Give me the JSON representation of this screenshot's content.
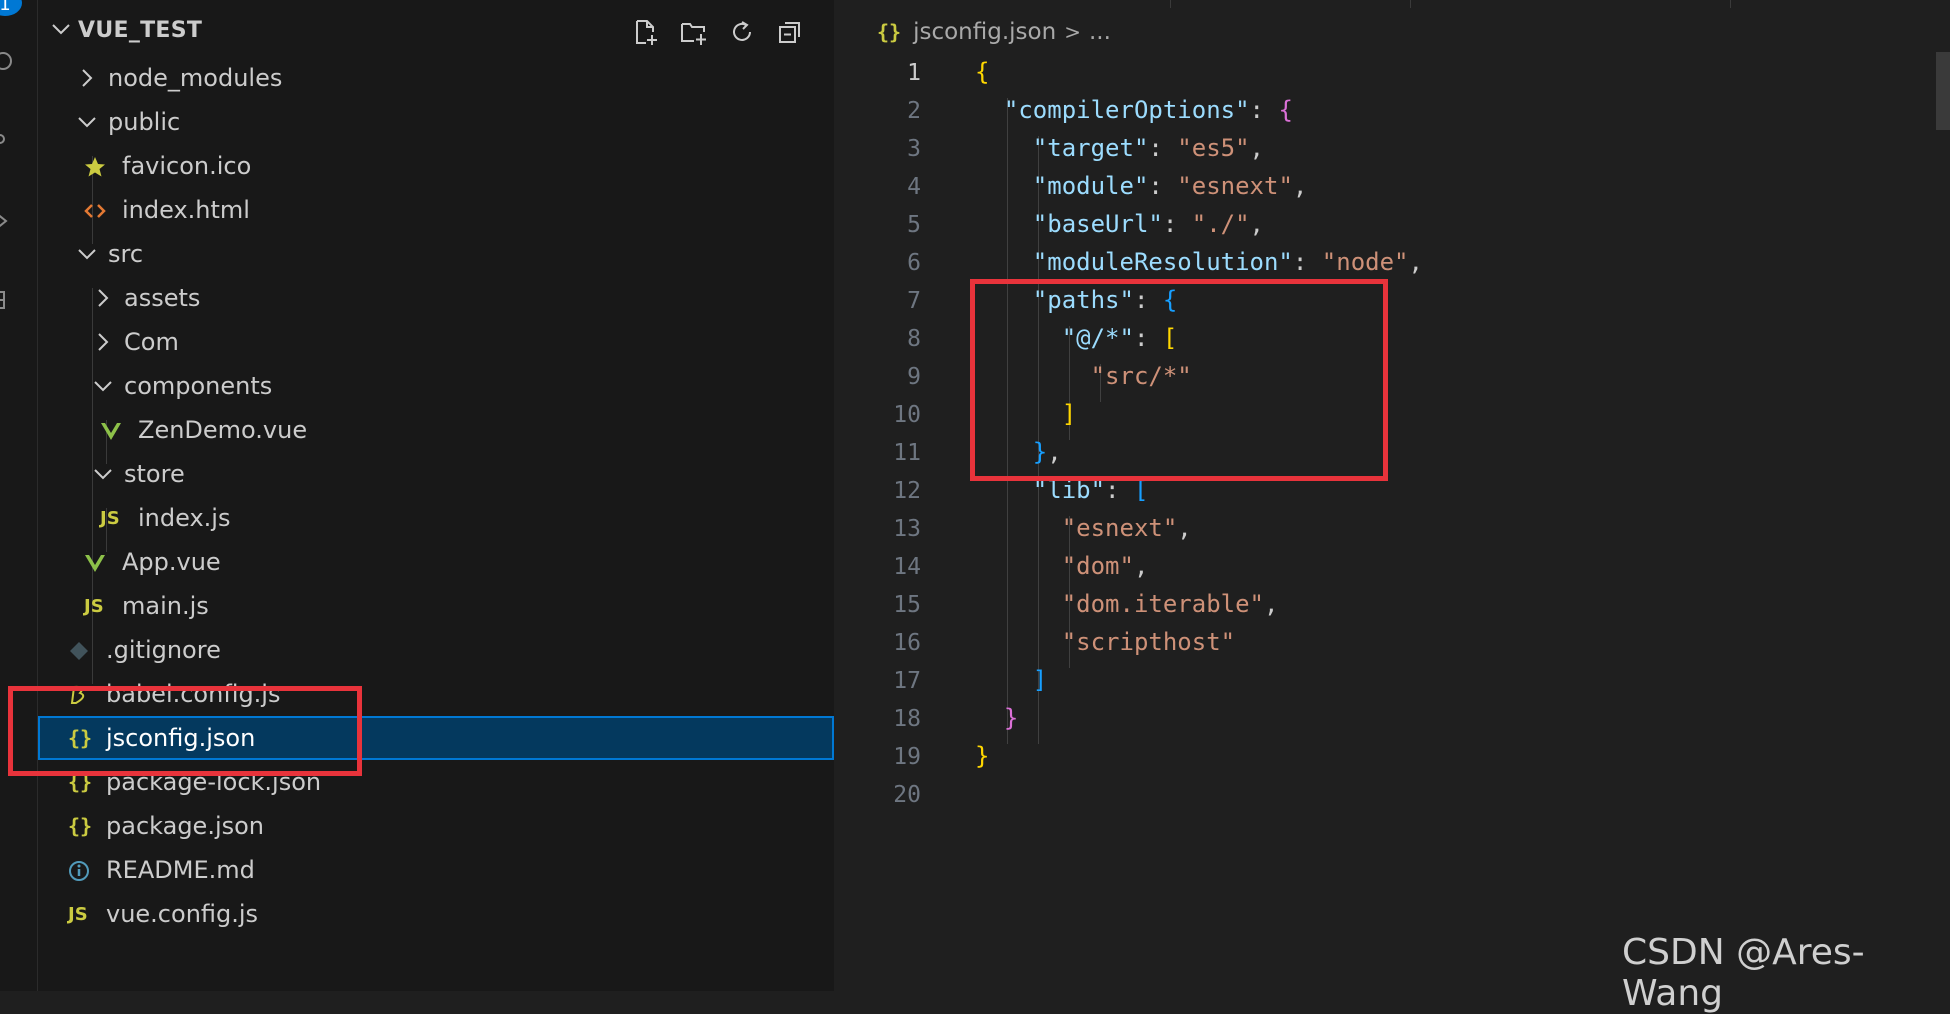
{
  "activity_bar": {
    "badge": "1",
    "icons": [
      "search-icon",
      "source-control-icon",
      "run-debug-icon",
      "extensions-icon"
    ]
  },
  "explorer": {
    "title": "VUE_TEST",
    "actions": [
      "new-file-icon",
      "new-folder-icon",
      "refresh-icon",
      "collapse-all-icon"
    ],
    "items": [
      {
        "label": "node_modules",
        "kind": "folder",
        "expanded": false,
        "icon": "chevron-right-icon"
      },
      {
        "label": "public",
        "kind": "folder",
        "expanded": true,
        "icon": "chevron-down-icon"
      },
      {
        "label": "favicon.ico",
        "kind": "file",
        "icon": "star-icon"
      },
      {
        "label": "index.html",
        "kind": "file",
        "icon": "html-icon"
      },
      {
        "label": "src",
        "kind": "folder",
        "expanded": true,
        "icon": "chevron-down-icon"
      },
      {
        "label": "assets",
        "kind": "folder",
        "expanded": false,
        "icon": "chevron-right-icon"
      },
      {
        "label": "Com",
        "kind": "folder",
        "expanded": false,
        "icon": "chevron-right-icon"
      },
      {
        "label": "components",
        "kind": "folder",
        "expanded": true,
        "icon": "chevron-down-icon"
      },
      {
        "label": "ZenDemo.vue",
        "kind": "file",
        "icon": "vue-icon"
      },
      {
        "label": "store",
        "kind": "folder",
        "expanded": true,
        "icon": "chevron-down-icon"
      },
      {
        "label": "index.js",
        "kind": "file",
        "icon": "js-icon",
        "icon_text": "JS"
      },
      {
        "label": "App.vue",
        "kind": "file",
        "icon": "vue-icon"
      },
      {
        "label": "main.js",
        "kind": "file",
        "icon": "js-icon",
        "icon_text": "JS"
      },
      {
        "label": ".gitignore",
        "kind": "file",
        "icon": "git-icon"
      },
      {
        "label": "babel.config.js",
        "kind": "file",
        "icon": "babel-icon"
      },
      {
        "label": "jsconfig.json",
        "kind": "file",
        "icon": "json-icon",
        "icon_text": "{}",
        "selected": true
      },
      {
        "label": "package-lock.json",
        "kind": "file",
        "icon": "json-icon",
        "icon_text": "{}"
      },
      {
        "label": "package.json",
        "kind": "file",
        "icon": "json-icon",
        "icon_text": "{}"
      },
      {
        "label": "README.md",
        "kind": "file",
        "icon": "info-icon"
      },
      {
        "label": "vue.config.js",
        "kind": "file",
        "icon": "js-icon",
        "icon_text": "JS"
      }
    ]
  },
  "editor": {
    "breadcrumb": {
      "icon_text": "{}",
      "file": "jsconfig.json",
      "separator": ">",
      "more": "..."
    },
    "active_line": 1,
    "line_numbers": [
      "1",
      "2",
      "3",
      "4",
      "5",
      "6",
      "7",
      "8",
      "9",
      "10",
      "11",
      "12",
      "13",
      "14",
      "15",
      "16",
      "17",
      "18",
      "19",
      "20"
    ]
  },
  "watermark": "CSDN @Ares-Wang",
  "colors": {
    "highlight_box": "#e8333b",
    "selection": "#04395e",
    "accent": "#0078d4"
  }
}
